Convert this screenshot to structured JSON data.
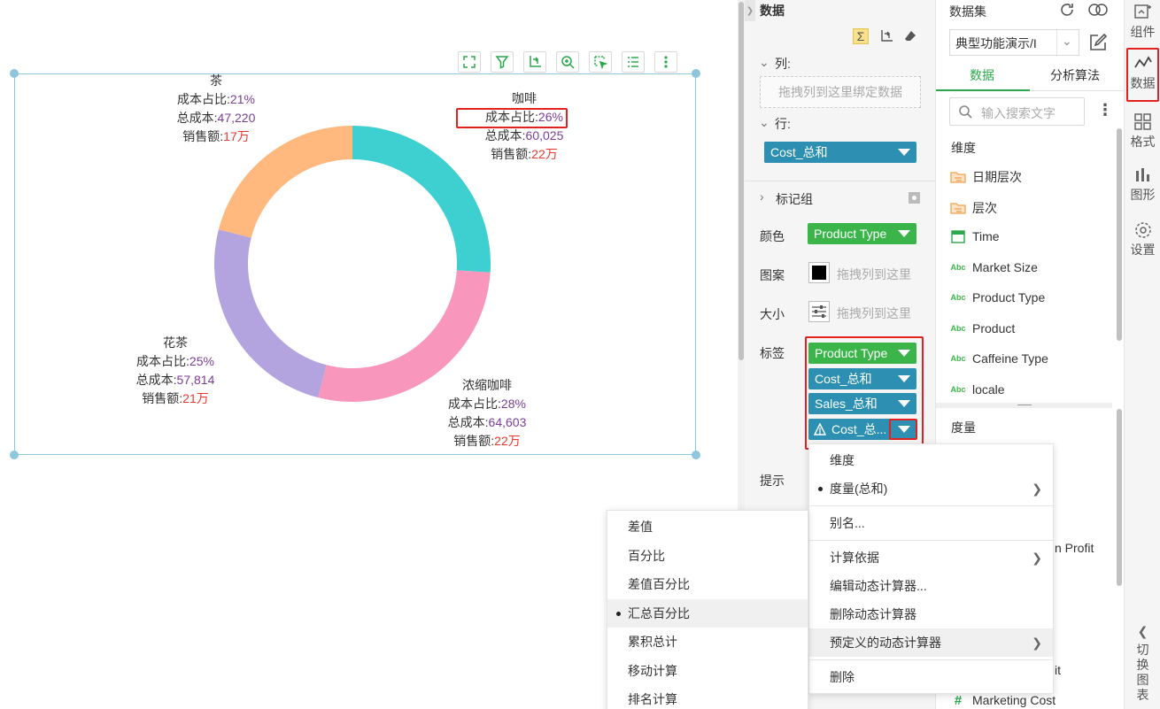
{
  "toolbar_icons": [
    "fullscreen-icon",
    "filter-icon",
    "axis-swap-icon",
    "zoom-icon",
    "select-icon",
    "list-icon",
    "more-icon"
  ],
  "chart_data": {
    "type": "pie",
    "donut": true,
    "slices": [
      {
        "name": "咖啡",
        "share": "26%",
        "cost": "60,025",
        "sales": "22万",
        "value": 26,
        "color": "#3ecfd0"
      },
      {
        "name": "浓缩咖啡",
        "share": "28%",
        "cost": "64,603",
        "sales": "22万",
        "value": 28,
        "color": "#f897bb"
      },
      {
        "name": "花茶",
        "share": "25%",
        "cost": "57,814",
        "sales": "21万",
        "value": 25,
        "color": "#b3a3de"
      },
      {
        "name": "茶",
        "share": "21%",
        "cost": "47,220",
        "sales": "17万",
        "value": 21,
        "color": "#ffb97f"
      }
    ],
    "label_keys": {
      "share": "成本占比:",
      "cost": "总成本:",
      "sales": "销售额:"
    }
  },
  "bind_panel": {
    "title": "数据",
    "columns_label": "列:",
    "columns_placeholder": "拖拽列到这里绑定数据",
    "rows_label": "行:",
    "rows_field": "Cost_总和",
    "marks_label": "标记组",
    "color_label": "颜色",
    "color_field": "Product Type",
    "pattern_label": "图案",
    "pattern_placeholder": "拖拽列到这里",
    "size_label": "大小",
    "size_placeholder": "拖拽列到这里",
    "label_label": "标签",
    "label_fields": [
      "Product Type",
      "Cost_总和",
      "Sales_总和",
      "Cost_总..."
    ],
    "tooltip_label": "提示"
  },
  "data_panel": {
    "title": "数据集",
    "dataset": "典型功能演示/I",
    "tabs": [
      "数据",
      "分析算法"
    ],
    "search_placeholder": "输入搜索文字",
    "dimension_header": "维度",
    "dimensions": [
      {
        "label": "日期层次",
        "icon": "date-hierarchy-icon"
      },
      {
        "label": "层次",
        "icon": "hierarchy-icon"
      },
      {
        "label": "Time",
        "icon": "calendar-icon"
      },
      {
        "label": "Market Size",
        "icon": "text-field-icon"
      },
      {
        "label": "Product Type",
        "icon": "text-field-icon"
      },
      {
        "label": "Product",
        "icon": "text-field-icon"
      },
      {
        "label": "Caffeine Type",
        "icon": "text-field-icon"
      },
      {
        "label": "locale",
        "icon": "text-field-icon"
      }
    ],
    "measure_header": "度量",
    "partial_items": [
      "n Profit",
      "it"
    ],
    "last_measure": "Marketing Cost"
  },
  "rail": [
    {
      "label": "组件",
      "icon": "component-icon"
    },
    {
      "label": "数据",
      "icon": "data-icon"
    },
    {
      "label": "格式",
      "icon": "format-icon"
    },
    {
      "label": "图形",
      "icon": "graph-icon"
    },
    {
      "label": "设置",
      "icon": "settings-icon"
    },
    {
      "label": "切换图表",
      "icon": "switch-chart-icon"
    }
  ],
  "context_menu": {
    "items": [
      "维度",
      "度量(总和)",
      "别名...",
      "计算依据",
      "编辑动态计算器...",
      "删除动态计算器",
      "预定义的动态计算器",
      "删除"
    ]
  },
  "sub_menu": {
    "items": [
      "差值",
      "百分比",
      "差值百分比",
      "汇总百分比",
      "累积总计",
      "移动计算",
      "排名计算"
    ],
    "selected_index": 3
  }
}
